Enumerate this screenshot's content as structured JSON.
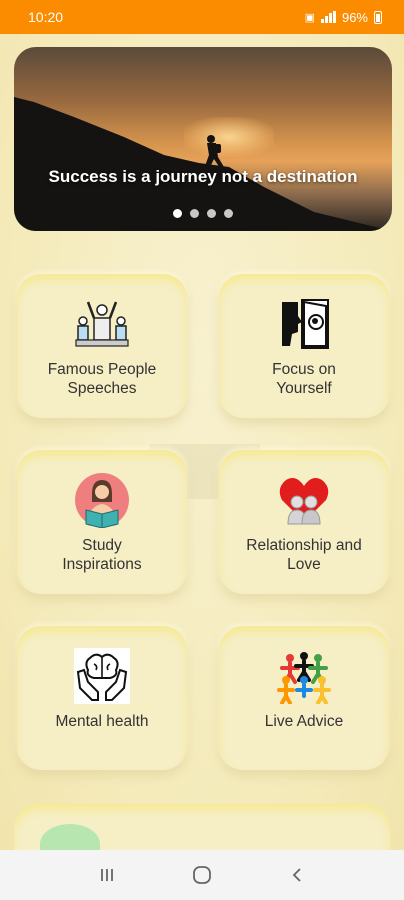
{
  "status_bar": {
    "time": "10:20",
    "battery": "96%"
  },
  "banner": {
    "quote": "Success is a journey not a destination",
    "slide_count": 4,
    "active_slide": 1
  },
  "categories": [
    {
      "label": "Famous People\nSpeeches",
      "icon": "people-cheering-icon"
    },
    {
      "label": "Focus on\nYourself",
      "icon": "head-door-icon"
    },
    {
      "label": "Study\nInspirations",
      "icon": "reading-woman-icon"
    },
    {
      "label": "Relationship and\nLove",
      "icon": "couple-heart-icon"
    },
    {
      "label": "Mental health",
      "icon": "brain-hands-icon"
    },
    {
      "label": "Live Advice",
      "icon": "people-circle-icon"
    }
  ],
  "colors": {
    "status_bar": "#fb8c00",
    "background": "#f6eec4"
  }
}
